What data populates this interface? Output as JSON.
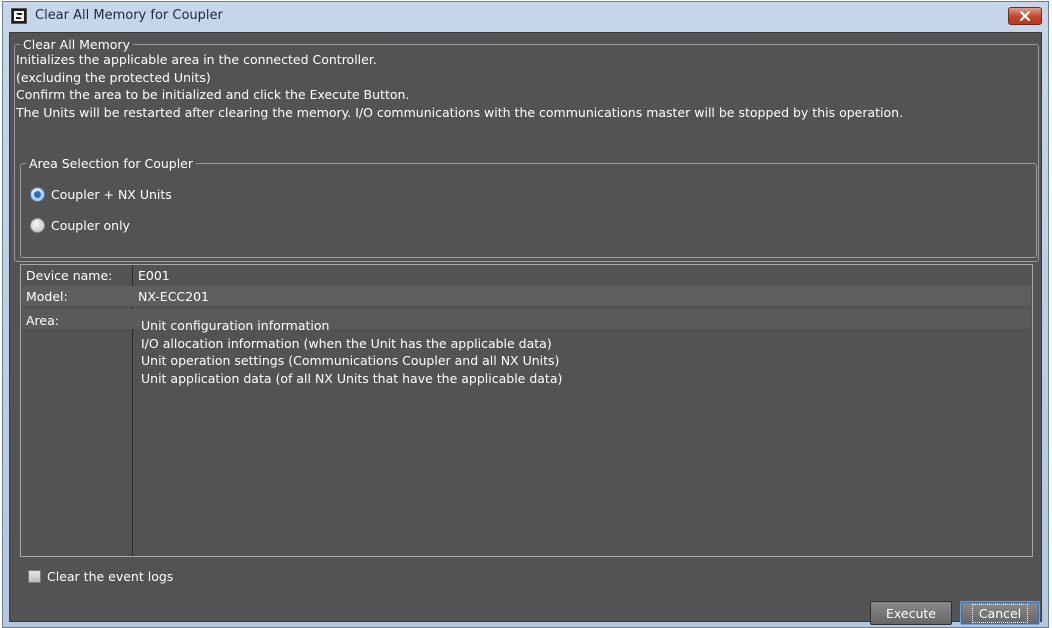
{
  "window": {
    "title": "Clear All Memory for Coupler"
  },
  "main_group": {
    "legend": "Clear All Memory",
    "description": [
      "Initializes the applicable area in the connected Controller.",
      "(excluding the protected Units)",
      "Confirm the area to be initialized and click the Execute Button.",
      "The Units will be restarted after clearing the memory. I/O communications with the communications master will be stopped by this operation."
    ]
  },
  "area_selection": {
    "legend": "Area Selection for Coupler",
    "options": [
      {
        "label": "Coupler + NX Units",
        "selected": true
      },
      {
        "label": "Coupler only",
        "selected": false
      }
    ]
  },
  "info": {
    "device_name_label": "Device name:",
    "device_name_value": "E001",
    "model_label": "Model:",
    "model_value": "NX-ECC201",
    "area_label": "Area:",
    "area_items": [
      "Unit configuration information",
      "I/O allocation information (when the Unit has the applicable data)",
      "Unit operation settings (Communications Coupler and all NX Units)",
      "Unit application data (of all NX Units that have the applicable data)"
    ]
  },
  "clear_event_logs": {
    "label": "Clear the event logs",
    "checked": false
  },
  "buttons": {
    "execute": "Execute",
    "cancel": "Cancel"
  },
  "icons": {
    "app": "app-logo-icon",
    "close": "close-icon"
  },
  "colors": {
    "panel_bg": "#535353",
    "title_bar": "#c6d7ea",
    "close_red": "#c4422a",
    "radio_selected": "#2a6bc2"
  }
}
